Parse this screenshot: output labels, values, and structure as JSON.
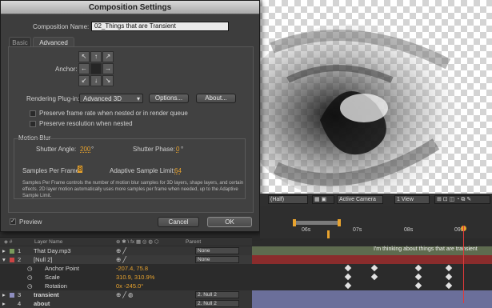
{
  "dialog": {
    "title": "Composition Settings",
    "comp_name_label": "Composition Name:",
    "comp_name_value": "02_Things that are Transient",
    "tabs": [
      "Basic",
      "Advanced"
    ],
    "anchor_label": "Anchor:",
    "anchor_arrows": [
      "↖",
      "↑",
      "↗",
      "←",
      "",
      "→",
      "↙",
      "↓",
      "↘"
    ],
    "rendering_label": "Rendering Plug-in:",
    "rendering_value": "Advanced 3D",
    "options_button": "Options...",
    "about_button": "About...",
    "preserve_frame_rate": "Preserve frame rate when nested or in render queue",
    "preserve_resolution": "Preserve resolution when nested",
    "motion_blur_title": "Motion Blur",
    "shutter_angle_label": "Shutter Angle:",
    "shutter_angle_value": "200",
    "shutter_angle_unit": "°",
    "shutter_phase_label": "Shutter Phase:",
    "shutter_phase_value": "0",
    "shutter_phase_unit": "°",
    "samples_label": "Samples Per Frame:",
    "samples_value": "8",
    "adaptive_label": "Adaptive Sample Limit:",
    "adaptive_value": "64",
    "description": "Samples Per Frame controls the number of motion blur samples for 3D layers, shape layers, and certain effects. 2D layer motion automatically uses more samples per frame when needed, up to the Adaptive Sample Limit.",
    "preview_label": "Preview",
    "cancel_button": "Cancel",
    "ok_button": "OK"
  },
  "viewer": {
    "resolution": "(Half)",
    "camera": "Active Camera",
    "view": "1 View"
  },
  "timeline": {
    "ticks": [
      "06s",
      "07s",
      "08s",
      "09s"
    ],
    "columns": {
      "layer_name": "Layer Name",
      "parent": "Parent"
    },
    "layers": [
      {
        "num": "1",
        "name": "That Day.mp3",
        "parent": "None"
      },
      {
        "num": "2",
        "name": "[Null 2]",
        "parent": "None"
      },
      {
        "num": "3",
        "name": "transient",
        "parent": "2. Null 2"
      },
      {
        "num": "4",
        "name": "about",
        "parent": "2. Null 2"
      }
    ],
    "properties": [
      {
        "name": "Anchor Point",
        "value": "-207.4, 75.8"
      },
      {
        "name": "Scale",
        "value": "310.9, 310.9%"
      },
      {
        "name": "Rotation",
        "value": "0x -245.0°"
      }
    ],
    "track_text": "I'm thinking about things that are transient"
  },
  "colors": {
    "accent_orange": "#e8a32e",
    "track_red": "#8a2c2c",
    "track_purple": "#6b6f9a",
    "playhead": "#e03a3a"
  }
}
